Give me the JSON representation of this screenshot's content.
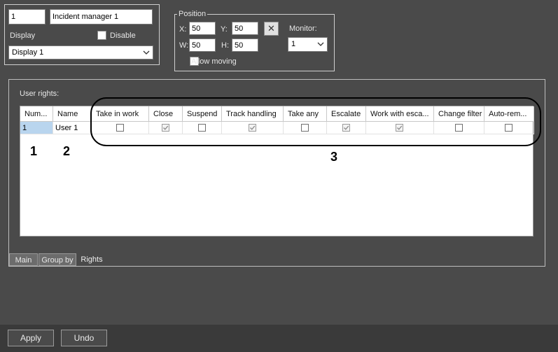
{
  "general": {
    "id_value": "1",
    "name_value": "Incident manager 1",
    "display_label": "Display",
    "disable_label": "Disable",
    "display_value": "Display 1"
  },
  "position": {
    "legend": "Position",
    "x_label": "X:",
    "x_value": "50",
    "y_label": "Y:",
    "y_value": "50",
    "w_label": "W:",
    "w_value": "50",
    "h_label": "H:",
    "h_value": "50",
    "reset_symbol": "✕",
    "monitor_label": "Monitor:",
    "monitor_value": "1",
    "allow_moving_label": "Allow moving"
  },
  "rights": {
    "title": "User rights:",
    "columns": [
      "Num...",
      "Name",
      "Take in work",
      "Close",
      "Suspend",
      "Track handling",
      "Take any",
      "Escalate",
      "Work with esca...",
      "Change filter",
      "Auto-rem..."
    ],
    "row": {
      "num": "1",
      "name": "User 1",
      "take_in_work": false,
      "close": true,
      "suspend": false,
      "track_handling": true,
      "take_any": false,
      "escalate": true,
      "work_with_escalation": true,
      "change_filter": false,
      "auto_remove": false
    },
    "annotations": [
      "1",
      "2",
      "3"
    ]
  },
  "tabs": [
    "Main",
    "Group by",
    "Rights"
  ],
  "footer": {
    "apply_label": "Apply",
    "undo_label": "Undo"
  }
}
